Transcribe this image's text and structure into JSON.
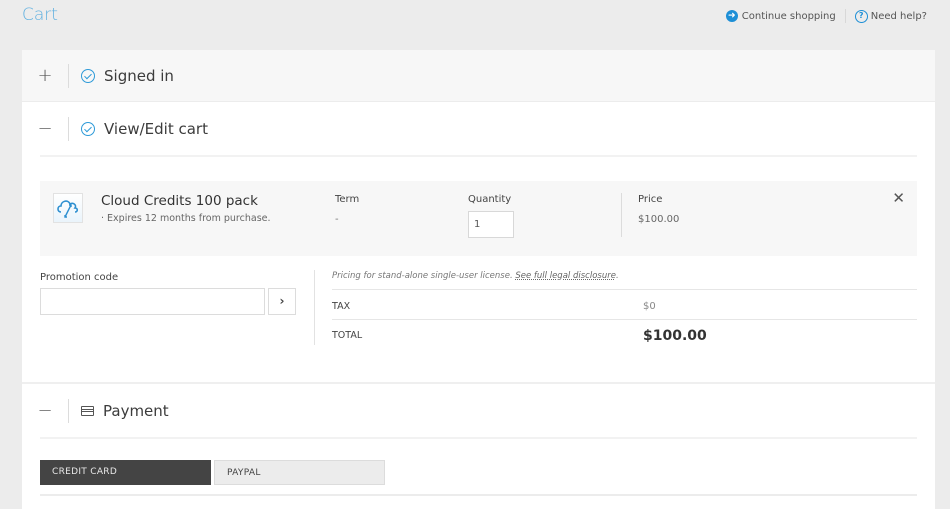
{
  "header": {
    "title": "Cart",
    "continue_shopping": "Continue shopping",
    "need_help": "Need help?"
  },
  "sections": {
    "signed_in": {
      "toggle": "+",
      "title": "Signed in",
      "icon": "check-circle-icon"
    },
    "view_edit_cart": {
      "toggle": "−",
      "title": "View/Edit cart",
      "icon": "check-circle-icon"
    },
    "payment": {
      "toggle": "−",
      "title": "Payment",
      "icon": "credit-card-icon"
    }
  },
  "cart_item": {
    "name": "Cloud Credits 100 pack",
    "subtitle": "· Expires 12 months from purchase.",
    "term_label": "Term",
    "term_value": "-",
    "quantity_label": "Quantity",
    "quantity_value": "1",
    "price_label": "Price",
    "price_value": "$100.00",
    "remove": "✕"
  },
  "promotion": {
    "label": "Promotion code",
    "value": "",
    "submit": "›"
  },
  "summary": {
    "legal_text": "Pricing for stand-alone single-user license. ",
    "legal_link": "See full legal disclosure",
    "legal_end": ".",
    "tax_label": "TAX",
    "tax_value": "$0",
    "total_label": "TOTAL",
    "total_value": "$100.00"
  },
  "payment": {
    "tabs": [
      {
        "label": "CREDIT CARD",
        "active": true
      },
      {
        "label": "PAYPAL",
        "active": false
      }
    ]
  },
  "colors": {
    "accent": "#1d8fd6",
    "title": "#5fb0e0",
    "active_tab": "#444444"
  }
}
